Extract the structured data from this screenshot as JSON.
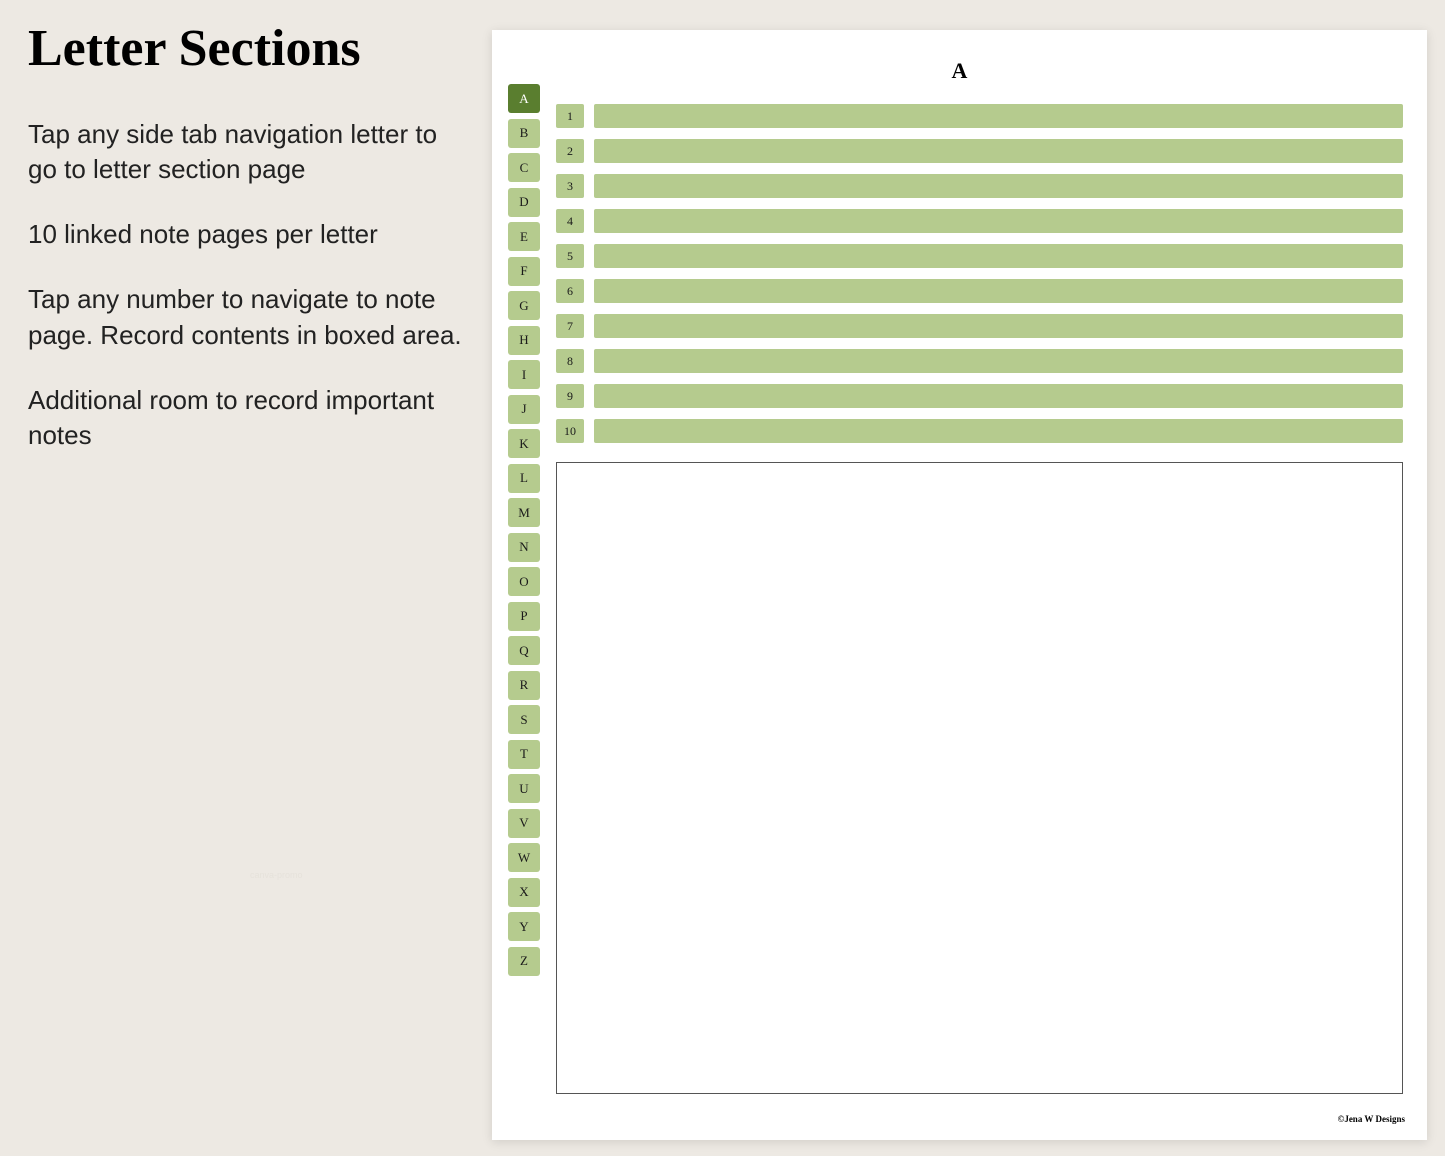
{
  "left": {
    "title": "Letter Sections",
    "p1": "Tap any side tab navigation letter to go to letter section page",
    "p2": "10 linked note pages per letter",
    "p3": "Tap any number to navigate to note page. Record contents in boxed area.",
    "p4": "Additional room to record important notes",
    "watermark": "canva-promo"
  },
  "page": {
    "heading": "A",
    "active_letter": "A",
    "side_tabs": [
      "A",
      "B",
      "C",
      "D",
      "E",
      "F",
      "G",
      "H",
      "I",
      "J",
      "K",
      "L",
      "M",
      "N",
      "O",
      "P",
      "Q",
      "R",
      "S",
      "T",
      "U",
      "V",
      "W",
      "X",
      "Y",
      "Z"
    ],
    "note_numbers": [
      "1",
      "2",
      "3",
      "4",
      "5",
      "6",
      "7",
      "8",
      "9",
      "10"
    ],
    "credit": "©Jena W Designs"
  },
  "colors": {
    "tab": "#b5cb8e",
    "tab_active": "#5a7e2f",
    "bg": "#ede9e3"
  }
}
